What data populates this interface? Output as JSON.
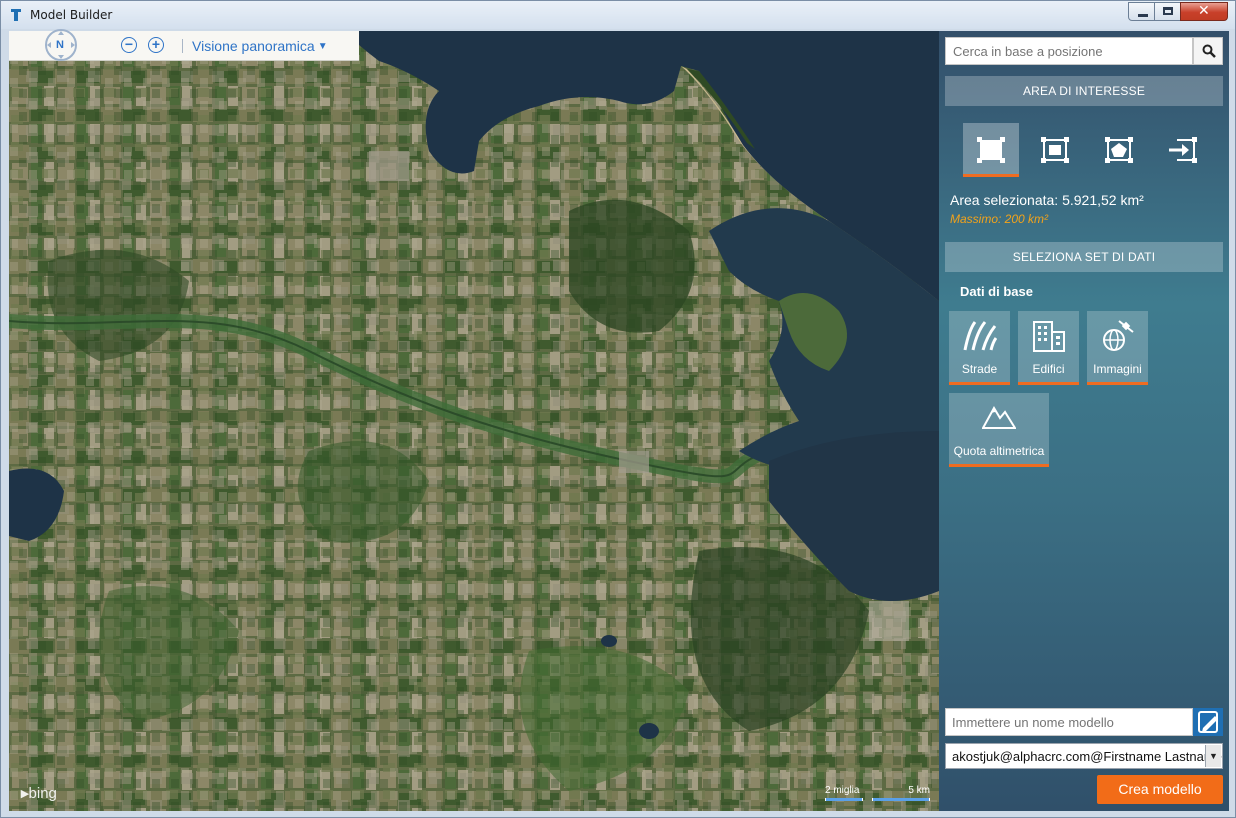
{
  "window": {
    "title": "Model Builder",
    "close_glyph": "✕"
  },
  "map": {
    "compass_label": "N",
    "zoom_out_glyph": "−",
    "zoom_in_glyph": "+",
    "view_mode": "Visione panoramica",
    "attribution": "bing",
    "scale_miles": "2 miglia",
    "scale_km": "5 km"
  },
  "panel": {
    "search_placeholder": "Cerca in base a posizione",
    "aoi_header": "AREA DI INTERESSE",
    "aoi_tools": [
      "rectangle-select-icon",
      "inset-rectangle-icon",
      "polygon-select-icon",
      "import-area-icon"
    ],
    "area_selected": "Area selezionata: 5.921,52 km²",
    "area_max": "Massimo: 200 km²",
    "dataset_header": "SELEZIONA SET DI DATI",
    "base_data_title": "Dati di base",
    "datasets": [
      {
        "label": "Strade",
        "icon": "roads-icon"
      },
      {
        "label": "Edifici",
        "icon": "buildings-icon"
      },
      {
        "label": "Immagini",
        "icon": "satellite-globe-icon"
      },
      {
        "label": "Quota altimetrica",
        "icon": "mountain-icon"
      }
    ],
    "model_name_placeholder": "Immettere un nome modello",
    "user_account": "akostjuk@alphacrc.com@Firstname Lastname",
    "create_button": "Crea modello"
  },
  "colors": {
    "accent_orange": "#f26c18",
    "link_blue": "#2f74c7",
    "warning_text": "#f3a31a",
    "water": "#1e3347",
    "panel_top": "#334f6a"
  }
}
